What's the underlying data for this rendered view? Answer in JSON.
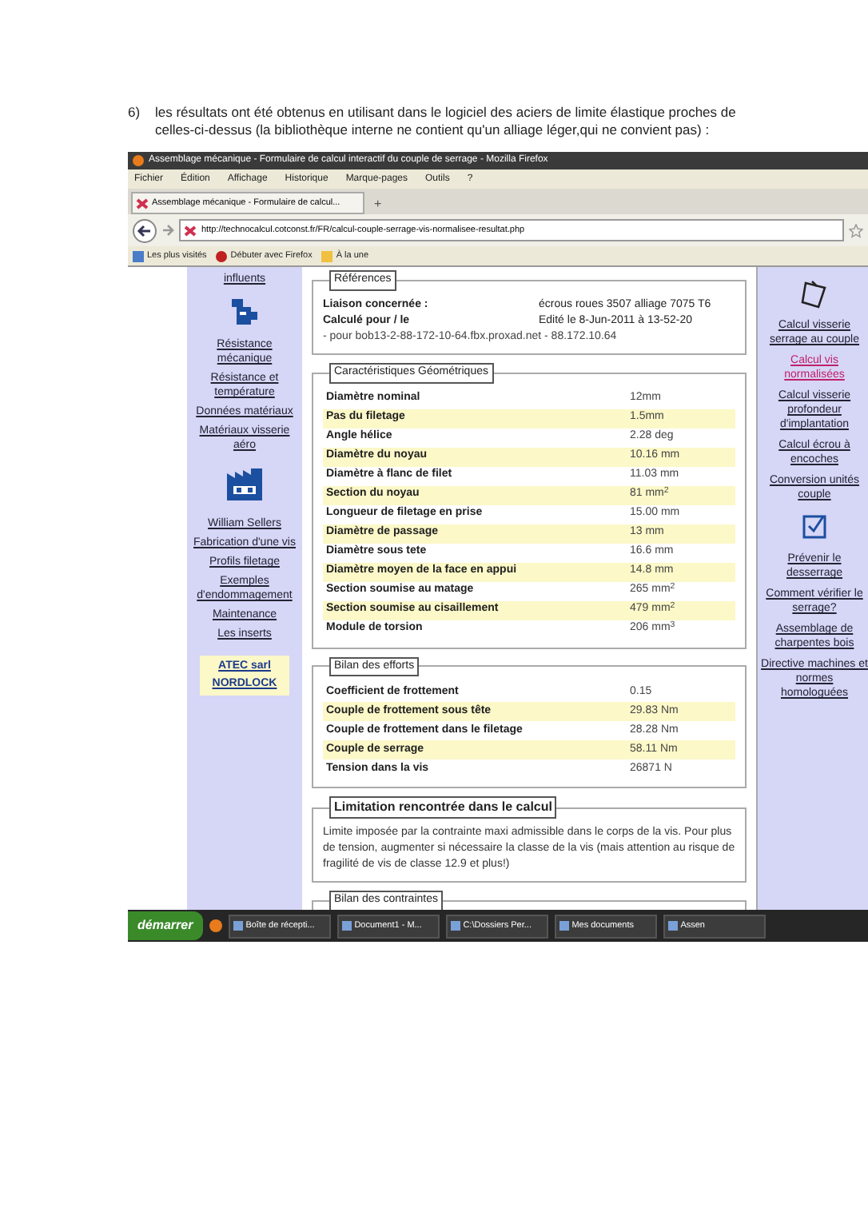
{
  "intro": {
    "number": "6)",
    "text": "les résultats ont été obtenus en utilisant dans le logiciel des aciers de limite élastique proches de celles-ci-dessus (la bibliothèque interne ne contient qu'un alliage léger,qui ne convient pas) :"
  },
  "window": {
    "title": "Assemblage mécanique - Formulaire de calcul interactif du couple de serrage - Mozilla Firefox",
    "menu": [
      "Fichier",
      "Édition",
      "Affichage",
      "Historique",
      "Marque-pages",
      "Outils",
      "?"
    ],
    "tab": {
      "title": "Assemblage mécanique - Formulaire de calcul...",
      "new_tab": "+"
    },
    "url": "http://technocalcul.cotconst.fr/FR/calcul-couple-serrage-vis-normalisee-resultat.php",
    "bookmarks": [
      "Les plus visités",
      "Débuter avec Firefox",
      "À la une"
    ]
  },
  "left_nav": [
    {
      "kind": "link",
      "text": "influents"
    },
    {
      "kind": "machine"
    },
    {
      "kind": "link",
      "text": "Résistance mécanique"
    },
    {
      "kind": "link",
      "text": "Résistance et température"
    },
    {
      "kind": "link",
      "text": "Données matériaux"
    },
    {
      "kind": "link",
      "text": "Matériaux visserie aéro"
    },
    {
      "kind": "factory"
    },
    {
      "kind": "link",
      "text": "William Sellers"
    },
    {
      "kind": "link",
      "text": "Fabrication d'une vis"
    },
    {
      "kind": "link",
      "text": "Profils filetage"
    },
    {
      "kind": "link",
      "text": "Exemples d'endommagement"
    },
    {
      "kind": "link",
      "text": "Maintenance"
    },
    {
      "kind": "link",
      "text": "Les inserts"
    },
    {
      "kind": "box",
      "lines": [
        "ATEC sarl",
        "NORDLOCK"
      ]
    }
  ],
  "references": {
    "title": "Références",
    "rows": [
      {
        "label": "Liaison concernée :",
        "value": "écrous roues 3507 alliage 7075 T6"
      },
      {
        "label": "Calculé pour / le",
        "value": "Edité le 8-Jun-2011 à 13-52-20"
      }
    ],
    "note": "- pour bob13-2-88-172-10-64.fbx.proxad.net - 88.172.10.64"
  },
  "geometry": {
    "title": "Caractéristiques Géométriques",
    "rows": [
      {
        "label": "Diamètre nominal",
        "value": "12mm",
        "highlighted": false
      },
      {
        "label": "Pas du filetage",
        "value": "1.5mm",
        "highlighted": true
      },
      {
        "label": "Angle hélice",
        "value": "2.28 deg",
        "highlighted": false
      },
      {
        "label": "Diamètre du noyau",
        "value": "10.16 mm",
        "highlighted": true
      },
      {
        "label": "Diamètre à flanc de filet",
        "value": "11.03 mm",
        "highlighted": false
      },
      {
        "label": "Section du noyau",
        "value": "81 mm$^{2}$",
        "highlighted": true
      },
      {
        "label": "Longueur de filetage en prise",
        "value": "15.00 mm",
        "highlighted": false
      },
      {
        "label": "Diamètre de passage",
        "value": "13 mm",
        "highlighted": true
      },
      {
        "label": "Diamètre sous tete",
        "value": "16.6 mm",
        "highlighted": false
      },
      {
        "label": "Diamètre moyen de la face en appui",
        "value": "14.8 mm",
        "highlighted": true
      },
      {
        "label": "Section soumise au matage",
        "value": "265 mm$^{2}$",
        "highlighted": false
      },
      {
        "label": "Section soumise au cisaillement",
        "value": "479 mm$^{2}$",
        "highlighted": true
      },
      {
        "label": "Module de torsion",
        "value": "206 mm$^{3}$",
        "highlighted": false
      }
    ]
  },
  "efforts": {
    "title": "Bilan des efforts",
    "rows": [
      {
        "label": "Coefficient de frottement",
        "value": "0.15",
        "highlighted": false
      },
      {
        "label": "Couple de frottement sous tête",
        "value": "29.83 Nm",
        "highlighted": true
      },
      {
        "label": "Couple de frottement dans le filetage",
        "value": "28.28 Nm",
        "highlighted": false
      },
      {
        "label": "Couple de serrage",
        "value": "58.11 Nm",
        "highlighted": true
      },
      {
        "label": "Tension dans la vis",
        "value": "26871 N",
        "highlighted": false
      }
    ]
  },
  "limitation": {
    "title": "Limitation rencontrée dans le calcul",
    "text": "Limite imposée par la contrainte maxi admissible dans le corps de la vis. Pour plus de tension, augmenter si nécessaire la classe de la vis (mais attention au risque de fragilité de vis de classe 12.9 et plus!)"
  },
  "stresses": {
    "title": "Bilan des contraintes"
  },
  "right_nav": [
    {
      "kind": "pen"
    },
    {
      "kind": "link",
      "text": "Calcul visserie serrage au couple",
      "selected": false
    },
    {
      "kind": "link",
      "text": "Calcul vis normalisées",
      "selected": true
    },
    {
      "kind": "link",
      "text": "Calcul visserie profondeur d'implantation",
      "selected": false
    },
    {
      "kind": "link",
      "text": "Calcul écrou à encoches",
      "selected": false
    },
    {
      "kind": "link",
      "text": "Conversion unités couple",
      "selected": false
    },
    {
      "kind": "check"
    },
    {
      "kind": "link",
      "text": "Prévenir le desserrage",
      "selected": false
    },
    {
      "kind": "link",
      "text": "Comment vérifier le serrage?",
      "selected": false
    },
    {
      "kind": "link",
      "text": "Assemblage de charpentes bois",
      "selected": false
    },
    {
      "kind": "link",
      "text": "Directive machines et normes homologuées",
      "selected": false
    }
  ],
  "taskbar": {
    "start": "démarrer",
    "items": [
      "Boîte de récepti...",
      "Document1 - M...",
      "C:\\Dossiers Per...",
      "Mes documents",
      "Assen"
    ]
  }
}
